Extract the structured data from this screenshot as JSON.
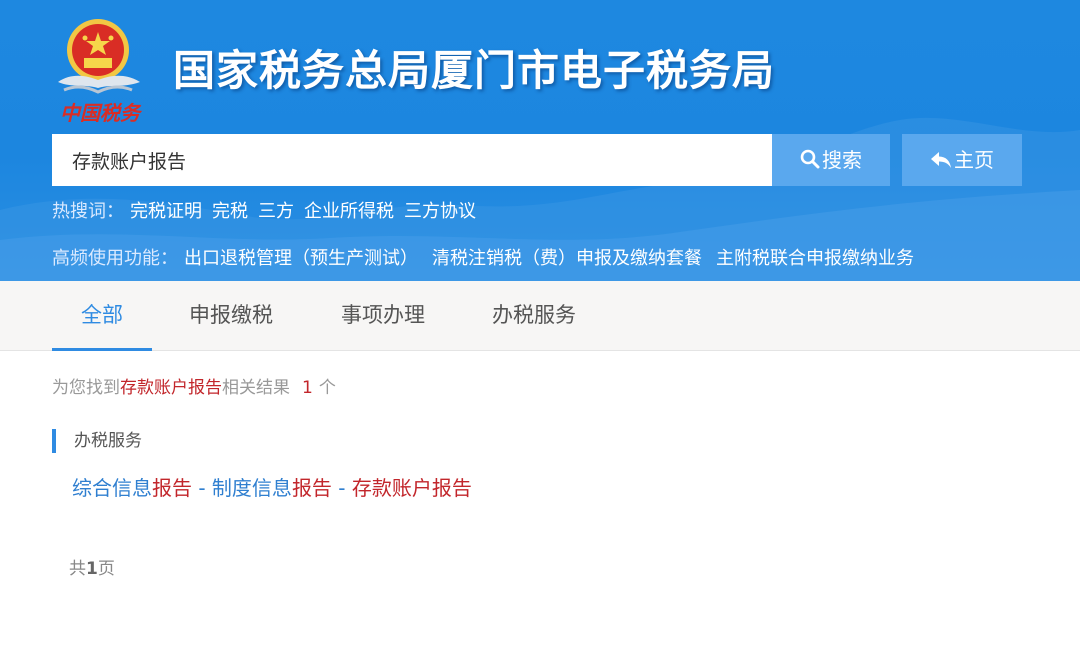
{
  "header": {
    "site_title": "国家税务总局厦门市电子税务局",
    "logo_text": "中国税务",
    "colors": {
      "header_bg": "#1e88e0",
      "button_bg": "#5aa8ee",
      "accent": "#2f8be2",
      "highlight": "#c2262b"
    }
  },
  "search": {
    "value": "存款账户报告",
    "search_button": "搜索",
    "search_icon": "magnifier-icon",
    "home_button": "主页",
    "home_icon": "back-arrow-icon"
  },
  "hot": {
    "label": "热搜词：",
    "keywords": [
      "完税证明",
      "完税",
      "三方",
      "企业所得税",
      "三方协议"
    ]
  },
  "frequent": {
    "label": "高频使用功能：",
    "functions": [
      "出口退税管理（预生产测试）",
      "清税注销税（费）申报及缴纳套餐",
      "主附税联合申报缴纳业务"
    ]
  },
  "tabs": [
    {
      "label": "全部",
      "active": true
    },
    {
      "label": "申报缴税",
      "active": false
    },
    {
      "label": "事项办理",
      "active": false
    },
    {
      "label": "办税服务",
      "active": false
    }
  ],
  "results": {
    "summary_prefix": "为您找到",
    "query": "存款账户报告",
    "summary_middle": "相关结果",
    "count": "1",
    "summary_suffix": "个",
    "section_title": "办税服务",
    "item_parts": [
      {
        "text": "综合信息",
        "hl": false
      },
      {
        "text": "报告",
        "hl": true
      },
      {
        "text": " - 制度信息",
        "hl": false
      },
      {
        "text": "报告",
        "hl": true
      },
      {
        "text": " - ",
        "hl": false
      },
      {
        "text": "存款账户报告",
        "hl": true
      }
    ]
  },
  "pager": {
    "prefix": "共",
    "pages": "1",
    "suffix": "页"
  }
}
